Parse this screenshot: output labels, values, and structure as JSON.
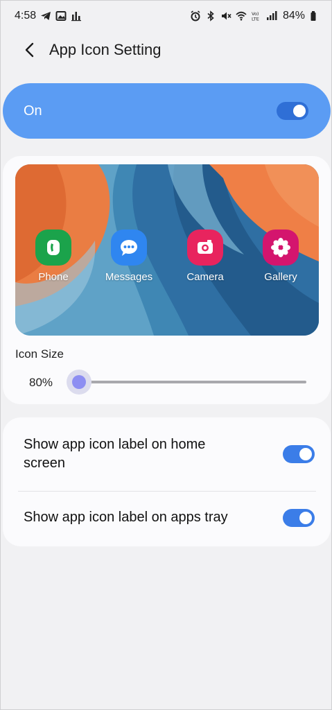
{
  "status_bar": {
    "time": "4:58",
    "battery": "84%",
    "left_icons": [
      "telegram-icon",
      "gallery-notification-icon",
      "stats-icon"
    ],
    "right_icons": [
      "alarm-icon",
      "bluetooth-icon",
      "mute-icon",
      "wifi-icon",
      "volte-icon",
      "signal-icon",
      "battery-icon"
    ]
  },
  "header": {
    "title": "App Icon Setting",
    "back_icon": "back-arrow-icon"
  },
  "master_switch": {
    "label": "On",
    "on": true
  },
  "preview": {
    "apps": [
      {
        "label": "Phone",
        "icon": "phone-icon",
        "color": "#1ba34b"
      },
      {
        "label": "Messages",
        "icon": "messages-icon",
        "color": "#2f86f0"
      },
      {
        "label": "Camera",
        "icon": "camera-icon",
        "color": "#e8245e"
      },
      {
        "label": "Gallery",
        "icon": "gallery-icon",
        "color": "#d4156e"
      }
    ]
  },
  "icon_size": {
    "label": "Icon Size",
    "value_text": "80%",
    "level": 0.0
  },
  "options": [
    {
      "label": "Show app icon label on home screen",
      "on": true
    },
    {
      "label": "Show app icon label on apps tray",
      "on": true
    }
  ],
  "colors": {
    "accent": "#3b7de8",
    "master_bg": "#5b9cf3",
    "card_bg": "#fbfbfd",
    "page_bg": "#f1f1f3"
  }
}
